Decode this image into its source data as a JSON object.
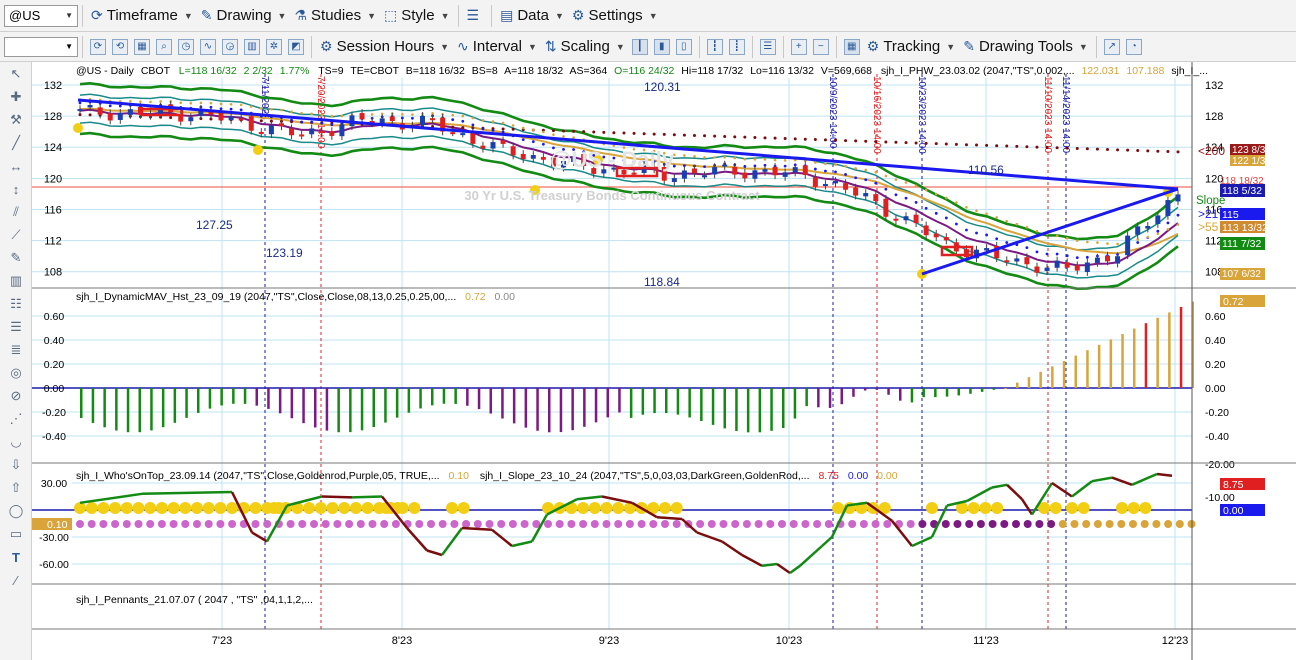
{
  "toolbar1": {
    "symbol": "@US",
    "timeframe": "Timeframe",
    "drawing": "Drawing",
    "studies": "Studies",
    "style": "Style",
    "data": "Data",
    "settings": "Settings"
  },
  "toolbar2": {
    "session_hours": "Session Hours",
    "interval": "Interval",
    "scaling": "Scaling",
    "tracking": "Tracking",
    "drawing_tools": "Drawing Tools"
  },
  "icons": [
    "timeframe-icon",
    "drawing-icon",
    "studies-icon",
    "style-icon",
    "layout-icon",
    "data-icon",
    "settings-icon",
    "session-hours-icon",
    "interval-icon",
    "scaling-icon",
    "candles-icon",
    "tracking-icon",
    "drawing-tools-icon",
    "chart-line-icon",
    "zoom-in-icon",
    "zoom-out-icon"
  ],
  "colors": {
    "background": "#ffffff",
    "up": "#1a3fae",
    "down": "#e02020",
    "green": "#138a13",
    "purple": "#7b1a82",
    "goldenrod": "#d9a43a",
    "darkred": "#7a0d0d",
    "trend": "#1a1aee"
  },
  "price_pane": {
    "header": {
      "symbol": "@US - Daily",
      "exchange": "CBOT",
      "last": "L=118 16/32",
      "change": "2 2/32",
      "pct": "1.77%",
      "ts": "TS=9",
      "te": "TE=CBOT",
      "bid": "B=118 16/32",
      "bs": "BS=8",
      "ask": "A=118 18/32",
      "as": "AS=364",
      "open": "O=116 24/32",
      "high": "Hi=118 17/32",
      "low": "Lo=116 13/32",
      "vol": "V=569,668",
      "study": "sjh_I_PHW_23.03.02 (2047,\"TS\",0.002,...",
      "v1": "122.031",
      "v2": "107.188",
      "trail": "sjh_I_..."
    },
    "y_ticks": [
      "132",
      "128",
      "124",
      "120",
      "116",
      "112",
      "108"
    ],
    "watermark": "@US - Daily",
    "watermark_sub": "30 Yr U.S. Treasury Bonds Continuous Contract",
    "annotations": [
      "127.25",
      "123.19",
      "120.31",
      "118.84",
      "110.56"
    ],
    "vlines": [
      "7/11/2023",
      "7/20/2023 14:00",
      "10/9/2023 14:00",
      "10/16/2023 14:00",
      "10/23/2023 14:00",
      "11/10/2023 14:00",
      "11/14/2023 14:00"
    ],
    "flags": {
      "ma200": "<200",
      "price200": "123 8/32",
      "price122": "122 1/32",
      "hline": "118 18/32",
      "last": "118 5/32",
      "slope": "Slope",
      "gt21": ">21",
      "p115": "115",
      "gt55": ">55",
      "p113": "113 13/32",
      "p111": "111 7/32",
      "p107": "107 6/32"
    }
  },
  "pane2": {
    "title": "sjh_I_DynamicMAV_Hst_23_09_19 (2047,\"TS\",Close,Close,08,13,0.25,0.25,00,...",
    "v1": "0.72",
    "v2": "0.00",
    "y_ticks": [
      "0.60",
      "0.40",
      "0.20",
      "0.00",
      "-0.20",
      "-0.40"
    ],
    "flag": "0.72"
  },
  "pane3": {
    "title1": "sjh_I_Who'sOnTop_23.09.14 (2047,\"TS\",Close,Goldenrod,Purple,05,  TRUE,...",
    "v1": "0.10",
    "title2": "sjh_I_Slope_23_10_24 (2047,\"TS\",5,0,03,03,DarkGreen,GoldenRod,...",
    "s1": "8.75",
    "s2": "0.00",
    "s3": "0.00",
    "left_ticks": [
      "30.00",
      "0.10",
      "-30.00",
      "-60.00"
    ],
    "right_ticks": [
      "-10.00",
      "-20.00"
    ],
    "flag1": "8.75",
    "flag2": "0.00"
  },
  "pane4": {
    "title": "sjh_I_Pennants_21.07.07 (  2047  ,  \"TS\" ,04,1,1,2,..."
  },
  "x_labels": [
    "7'23",
    "8'23",
    "9'23",
    "10'23",
    "11'23",
    "12'23"
  ]
}
